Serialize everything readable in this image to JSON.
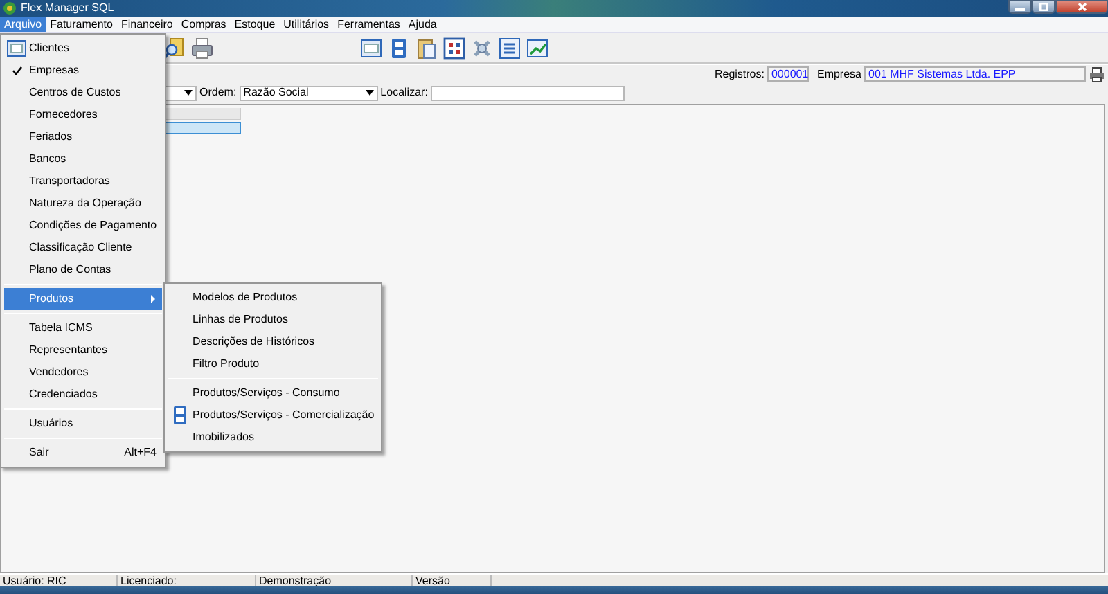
{
  "window": {
    "title": "Flex Manager SQL"
  },
  "menubar": [
    {
      "label": "Arquivo",
      "selected": true
    },
    {
      "label": "Faturamento",
      "selected": false
    },
    {
      "label": "Financeiro",
      "selected": false
    },
    {
      "label": "Compras",
      "selected": false
    },
    {
      "label": "Estoque",
      "selected": false
    },
    {
      "label": "Utilitários",
      "selected": false
    },
    {
      "label": "Ferramentas",
      "selected": false
    },
    {
      "label": "Ajuda",
      "selected": false
    }
  ],
  "info": {
    "registros_label": "Registros:",
    "registros_value": "000001",
    "empresa_label": "Empresa",
    "empresa_value": "001 MHF Sistemas Ltda. EPP"
  },
  "filter": {
    "ordem_label": "Ordem:",
    "ordem_value": "Razão Social",
    "localizar_label": "Localizar:"
  },
  "arquivo_menu": [
    {
      "kind": "icon",
      "label": "Clientes",
      "checked": false,
      "selected": false
    },
    {
      "kind": "item",
      "label": "Empresas",
      "checked": true,
      "selected": false
    },
    {
      "kind": "item",
      "label": "Centros de Custos",
      "checked": false,
      "selected": false
    },
    {
      "kind": "item",
      "label": "Fornecedores",
      "checked": false,
      "selected": false
    },
    {
      "kind": "item",
      "label": "Feriados",
      "checked": false,
      "selected": false
    },
    {
      "kind": "item",
      "label": "Bancos",
      "checked": false,
      "selected": false
    },
    {
      "kind": "item",
      "label": "Transportadoras",
      "checked": false,
      "selected": false
    },
    {
      "kind": "item",
      "label": "Natureza da Operação",
      "checked": false,
      "selected": false
    },
    {
      "kind": "item",
      "label": "Condições de Pagamento",
      "checked": false,
      "selected": false
    },
    {
      "kind": "item",
      "label": "Classificação Cliente",
      "checked": false,
      "selected": false
    },
    {
      "kind": "item",
      "label": "Plano de Contas",
      "checked": false,
      "selected": false
    },
    {
      "kind": "separator"
    },
    {
      "kind": "submenu",
      "label": "Produtos",
      "checked": false,
      "selected": true
    },
    {
      "kind": "separator"
    },
    {
      "kind": "item",
      "label": "Tabela ICMS",
      "checked": false,
      "selected": false
    },
    {
      "kind": "item",
      "label": "Representantes",
      "checked": false,
      "selected": false
    },
    {
      "kind": "item",
      "label": "Vendedores",
      "checked": false,
      "selected": false
    },
    {
      "kind": "item",
      "label": "Credenciados",
      "checked": false,
      "selected": false
    },
    {
      "kind": "separator"
    },
    {
      "kind": "item",
      "label": "Usuários",
      "checked": false,
      "selected": false
    },
    {
      "kind": "separator"
    },
    {
      "kind": "item",
      "label": "Sair",
      "shortcut": "Alt+F4",
      "checked": false,
      "selected": false
    }
  ],
  "produtos_submenu": [
    {
      "kind": "item",
      "label": "Modelos de Produtos"
    },
    {
      "kind": "item",
      "label": "Linhas de Produtos"
    },
    {
      "kind": "item",
      "label": "Descrições de Históricos"
    },
    {
      "kind": "item",
      "label": "Filtro Produto"
    },
    {
      "kind": "separator"
    },
    {
      "kind": "item",
      "label": "Produtos/Serviços - Consumo"
    },
    {
      "kind": "icon",
      "label": "Produtos/Serviços - Comercialização"
    },
    {
      "kind": "item",
      "label": "Imobilizados"
    }
  ],
  "status_bar": [
    "Usuário: RIC",
    "Licenciado:",
    "Demonstração",
    "Versão"
  ]
}
